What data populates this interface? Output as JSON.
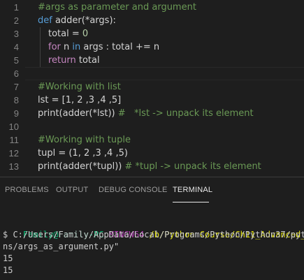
{
  "editor": {
    "lines": [
      {
        "n": "1",
        "parts": [
          {
            "t": "#args as parameter and argument",
            "c": "c-comment"
          }
        ]
      },
      {
        "n": "2",
        "parts": [
          {
            "t": "def",
            "c": "c-kw"
          },
          {
            "t": " adder(*args):",
            "c": ""
          }
        ]
      },
      {
        "n": "3",
        "indent": true,
        "parts": [
          {
            "t": "total = ",
            "c": ""
          },
          {
            "t": "0",
            "c": "c-num"
          }
        ]
      },
      {
        "n": "4",
        "indent": true,
        "parts": [
          {
            "t": "for",
            "c": "c-ctrl"
          },
          {
            "t": " n ",
            "c": ""
          },
          {
            "t": "in",
            "c": "c-kw"
          },
          {
            "t": " args : total += n",
            "c": ""
          }
        ]
      },
      {
        "n": "5",
        "indent": true,
        "parts": [
          {
            "t": "return",
            "c": "c-ctrl"
          },
          {
            "t": " total",
            "c": ""
          }
        ]
      },
      {
        "n": "6",
        "parts": []
      },
      {
        "n": "7",
        "parts": [
          {
            "t": "#Working with list",
            "c": "c-comment"
          }
        ]
      },
      {
        "n": "8",
        "parts": [
          {
            "t": "lst = [1, 2 ,3 ,4 ,5]",
            "c": ""
          }
        ]
      },
      {
        "n": "9",
        "parts": [
          {
            "t": "print(adder(*lst)) #   *lst -> unpack its element",
            "c": "mixed9"
          }
        ]
      },
      {
        "n": "10",
        "parts": []
      },
      {
        "n": "11",
        "parts": [
          {
            "t": "#Working with tuple",
            "c": "c-comment"
          }
        ]
      },
      {
        "n": "12",
        "parts": [
          {
            "t": "tupl = (1, 2 ,3 ,4 ,5)",
            "c": ""
          }
        ]
      },
      {
        "n": "13",
        "parts": [
          {
            "t": "print(adder(*tupl)) # *tupl -> unpack its element",
            "c": "mixed13"
          }
        ]
      }
    ],
    "line9": {
      "code": "print(adder(*lst)) ",
      "comment": "#   *lst -> unpack its element"
    },
    "line13": {
      "code": "print(adder(*tupl)) ",
      "comment": "# *tupl -> unpack its element"
    }
  },
  "panel": {
    "tabs": [
      {
        "label": "PROBLEMS",
        "active": false
      },
      {
        "label": "OUTPUT",
        "active": false
      },
      {
        "label": "DEBUG CONSOLE",
        "active": false
      },
      {
        "label": "TERMINAL",
        "active": true
      }
    ]
  },
  "terminal": {
    "prompt_user": "Family@Family-PC",
    "prompt_env": "MINGW64",
    "prompt_path": "/b/Python Course/Ch11_Advanced_functi",
    "command_line1": "$ C:/Users/Family/AppData/Local/Programs/Python/Python37/pytho",
    "command_line2": "ns/args_as_argument.py\"",
    "output": [
      "15",
      "15"
    ]
  },
  "colors": {
    "background": "#1e1e1e",
    "comment": "#6a9955",
    "keyword": "#569cd6",
    "control": "#c586c0",
    "number": "#b5cea8",
    "terminal_user": "#0dbc79",
    "terminal_env": "#bc3fbc",
    "terminal_path": "#e5e510"
  }
}
